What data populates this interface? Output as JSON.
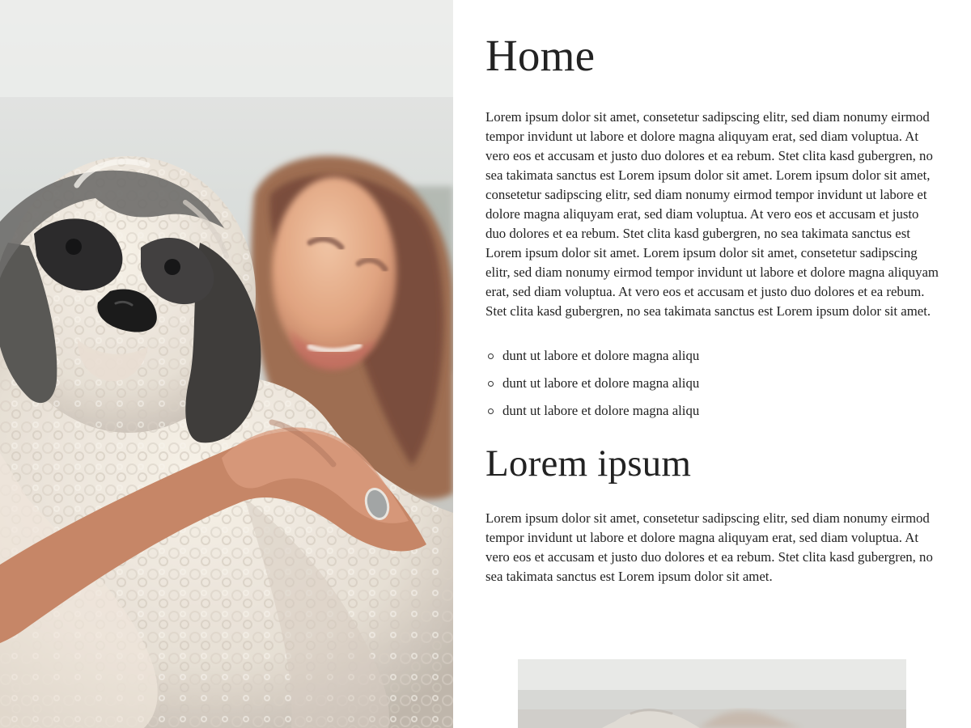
{
  "page": {
    "title": "Home",
    "intro": "Lorem ipsum dolor sit amet, consetetur sadipscing elitr, sed diam nonumy eirmod tempor invidunt ut labore et dolore magna aliquyam erat, sed diam voluptua. At vero eos et accusam et justo duo dolores et ea rebum. Stet clita kasd gubergren, no sea takimata sanctus est Lorem ipsum dolor sit amet. Lorem ipsum dolor sit amet, consetetur sadipscing elitr, sed diam nonumy eirmod tempor invidunt ut labore et dolore magna aliquyam erat, sed diam voluptua. At vero eos et accusam et justo duo dolores et ea rebum. Stet clita kasd gubergren, no sea takimata sanctus est Lorem ipsum dolor sit amet. Lorem ipsum dolor sit amet, consetetur sadipscing elitr, sed diam nonumy eirmod tempor invidunt ut labore et dolore magna aliquyam erat, sed diam voluptua. At vero eos et accusam et justo duo dolores et ea rebum. Stet clita kasd gubergren, no sea takimata sanctus est Lorem ipsum dolor sit amet.",
    "list": [
      "dunt ut labore et dolore magna aliqu",
      "dunt ut labore et dolore magna aliqu",
      "dunt ut labore et dolore magna aliqu"
    ],
    "section_title": "Lorem ipsum",
    "section_text": "Lorem ipsum dolor sit amet, consetetur sadipscing elitr, sed diam nonumy eirmod tempor invidunt ut labore et dolore magna aliquyam erat, sed diam voluptua. At vero eos et accusam et justo duo dolores et ea rebum. Stet clita kasd gubergren, no sea takimata sanctus est Lorem ipsum dolor sit amet."
  },
  "images": {
    "hero": "woman-holding-dog-photo",
    "preview": "dog-photo-preview"
  }
}
